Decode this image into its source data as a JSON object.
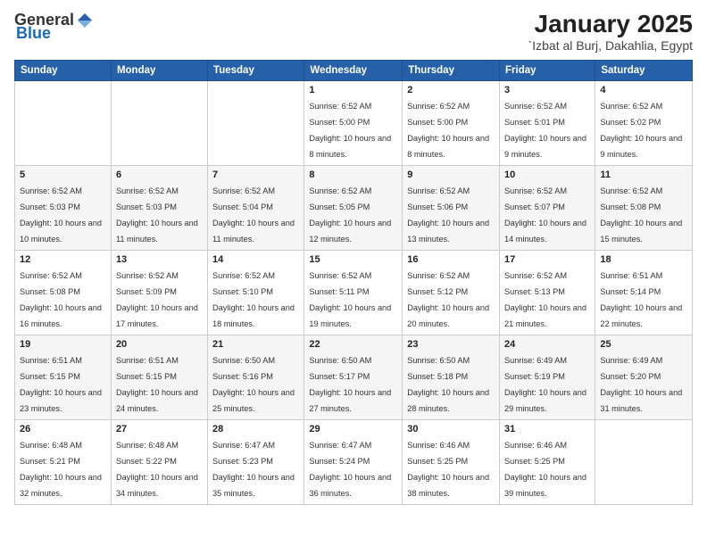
{
  "logo": {
    "general": "General",
    "blue": "Blue"
  },
  "header": {
    "title": "January 2025",
    "subtitle": "`Izbat al Burj, Dakahlia, Egypt"
  },
  "weekdays": [
    "Sunday",
    "Monday",
    "Tuesday",
    "Wednesday",
    "Thursday",
    "Friday",
    "Saturday"
  ],
  "weeks": [
    [
      {
        "day": "",
        "sunrise": "",
        "sunset": "",
        "daylight": ""
      },
      {
        "day": "",
        "sunrise": "",
        "sunset": "",
        "daylight": ""
      },
      {
        "day": "",
        "sunrise": "",
        "sunset": "",
        "daylight": ""
      },
      {
        "day": "1",
        "sunrise": "Sunrise: 6:52 AM",
        "sunset": "Sunset: 5:00 PM",
        "daylight": "Daylight: 10 hours and 8 minutes."
      },
      {
        "day": "2",
        "sunrise": "Sunrise: 6:52 AM",
        "sunset": "Sunset: 5:00 PM",
        "daylight": "Daylight: 10 hours and 8 minutes."
      },
      {
        "day": "3",
        "sunrise": "Sunrise: 6:52 AM",
        "sunset": "Sunset: 5:01 PM",
        "daylight": "Daylight: 10 hours and 9 minutes."
      },
      {
        "day": "4",
        "sunrise": "Sunrise: 6:52 AM",
        "sunset": "Sunset: 5:02 PM",
        "daylight": "Daylight: 10 hours and 9 minutes."
      }
    ],
    [
      {
        "day": "5",
        "sunrise": "Sunrise: 6:52 AM",
        "sunset": "Sunset: 5:03 PM",
        "daylight": "Daylight: 10 hours and 10 minutes."
      },
      {
        "day": "6",
        "sunrise": "Sunrise: 6:52 AM",
        "sunset": "Sunset: 5:03 PM",
        "daylight": "Daylight: 10 hours and 11 minutes."
      },
      {
        "day": "7",
        "sunrise": "Sunrise: 6:52 AM",
        "sunset": "Sunset: 5:04 PM",
        "daylight": "Daylight: 10 hours and 11 minutes."
      },
      {
        "day": "8",
        "sunrise": "Sunrise: 6:52 AM",
        "sunset": "Sunset: 5:05 PM",
        "daylight": "Daylight: 10 hours and 12 minutes."
      },
      {
        "day": "9",
        "sunrise": "Sunrise: 6:52 AM",
        "sunset": "Sunset: 5:06 PM",
        "daylight": "Daylight: 10 hours and 13 minutes."
      },
      {
        "day": "10",
        "sunrise": "Sunrise: 6:52 AM",
        "sunset": "Sunset: 5:07 PM",
        "daylight": "Daylight: 10 hours and 14 minutes."
      },
      {
        "day": "11",
        "sunrise": "Sunrise: 6:52 AM",
        "sunset": "Sunset: 5:08 PM",
        "daylight": "Daylight: 10 hours and 15 minutes."
      }
    ],
    [
      {
        "day": "12",
        "sunrise": "Sunrise: 6:52 AM",
        "sunset": "Sunset: 5:08 PM",
        "daylight": "Daylight: 10 hours and 16 minutes."
      },
      {
        "day": "13",
        "sunrise": "Sunrise: 6:52 AM",
        "sunset": "Sunset: 5:09 PM",
        "daylight": "Daylight: 10 hours and 17 minutes."
      },
      {
        "day": "14",
        "sunrise": "Sunrise: 6:52 AM",
        "sunset": "Sunset: 5:10 PM",
        "daylight": "Daylight: 10 hours and 18 minutes."
      },
      {
        "day": "15",
        "sunrise": "Sunrise: 6:52 AM",
        "sunset": "Sunset: 5:11 PM",
        "daylight": "Daylight: 10 hours and 19 minutes."
      },
      {
        "day": "16",
        "sunrise": "Sunrise: 6:52 AM",
        "sunset": "Sunset: 5:12 PM",
        "daylight": "Daylight: 10 hours and 20 minutes."
      },
      {
        "day": "17",
        "sunrise": "Sunrise: 6:52 AM",
        "sunset": "Sunset: 5:13 PM",
        "daylight": "Daylight: 10 hours and 21 minutes."
      },
      {
        "day": "18",
        "sunrise": "Sunrise: 6:51 AM",
        "sunset": "Sunset: 5:14 PM",
        "daylight": "Daylight: 10 hours and 22 minutes."
      }
    ],
    [
      {
        "day": "19",
        "sunrise": "Sunrise: 6:51 AM",
        "sunset": "Sunset: 5:15 PM",
        "daylight": "Daylight: 10 hours and 23 minutes."
      },
      {
        "day": "20",
        "sunrise": "Sunrise: 6:51 AM",
        "sunset": "Sunset: 5:15 PM",
        "daylight": "Daylight: 10 hours and 24 minutes."
      },
      {
        "day": "21",
        "sunrise": "Sunrise: 6:50 AM",
        "sunset": "Sunset: 5:16 PM",
        "daylight": "Daylight: 10 hours and 25 minutes."
      },
      {
        "day": "22",
        "sunrise": "Sunrise: 6:50 AM",
        "sunset": "Sunset: 5:17 PM",
        "daylight": "Daylight: 10 hours and 27 minutes."
      },
      {
        "day": "23",
        "sunrise": "Sunrise: 6:50 AM",
        "sunset": "Sunset: 5:18 PM",
        "daylight": "Daylight: 10 hours and 28 minutes."
      },
      {
        "day": "24",
        "sunrise": "Sunrise: 6:49 AM",
        "sunset": "Sunset: 5:19 PM",
        "daylight": "Daylight: 10 hours and 29 minutes."
      },
      {
        "day": "25",
        "sunrise": "Sunrise: 6:49 AM",
        "sunset": "Sunset: 5:20 PM",
        "daylight": "Daylight: 10 hours and 31 minutes."
      }
    ],
    [
      {
        "day": "26",
        "sunrise": "Sunrise: 6:48 AM",
        "sunset": "Sunset: 5:21 PM",
        "daylight": "Daylight: 10 hours and 32 minutes."
      },
      {
        "day": "27",
        "sunrise": "Sunrise: 6:48 AM",
        "sunset": "Sunset: 5:22 PM",
        "daylight": "Daylight: 10 hours and 34 minutes."
      },
      {
        "day": "28",
        "sunrise": "Sunrise: 6:47 AM",
        "sunset": "Sunset: 5:23 PM",
        "daylight": "Daylight: 10 hours and 35 minutes."
      },
      {
        "day": "29",
        "sunrise": "Sunrise: 6:47 AM",
        "sunset": "Sunset: 5:24 PM",
        "daylight": "Daylight: 10 hours and 36 minutes."
      },
      {
        "day": "30",
        "sunrise": "Sunrise: 6:46 AM",
        "sunset": "Sunset: 5:25 PM",
        "daylight": "Daylight: 10 hours and 38 minutes."
      },
      {
        "day": "31",
        "sunrise": "Sunrise: 6:46 AM",
        "sunset": "Sunset: 5:25 PM",
        "daylight": "Daylight: 10 hours and 39 minutes."
      },
      {
        "day": "",
        "sunrise": "",
        "sunset": "",
        "daylight": ""
      }
    ]
  ]
}
